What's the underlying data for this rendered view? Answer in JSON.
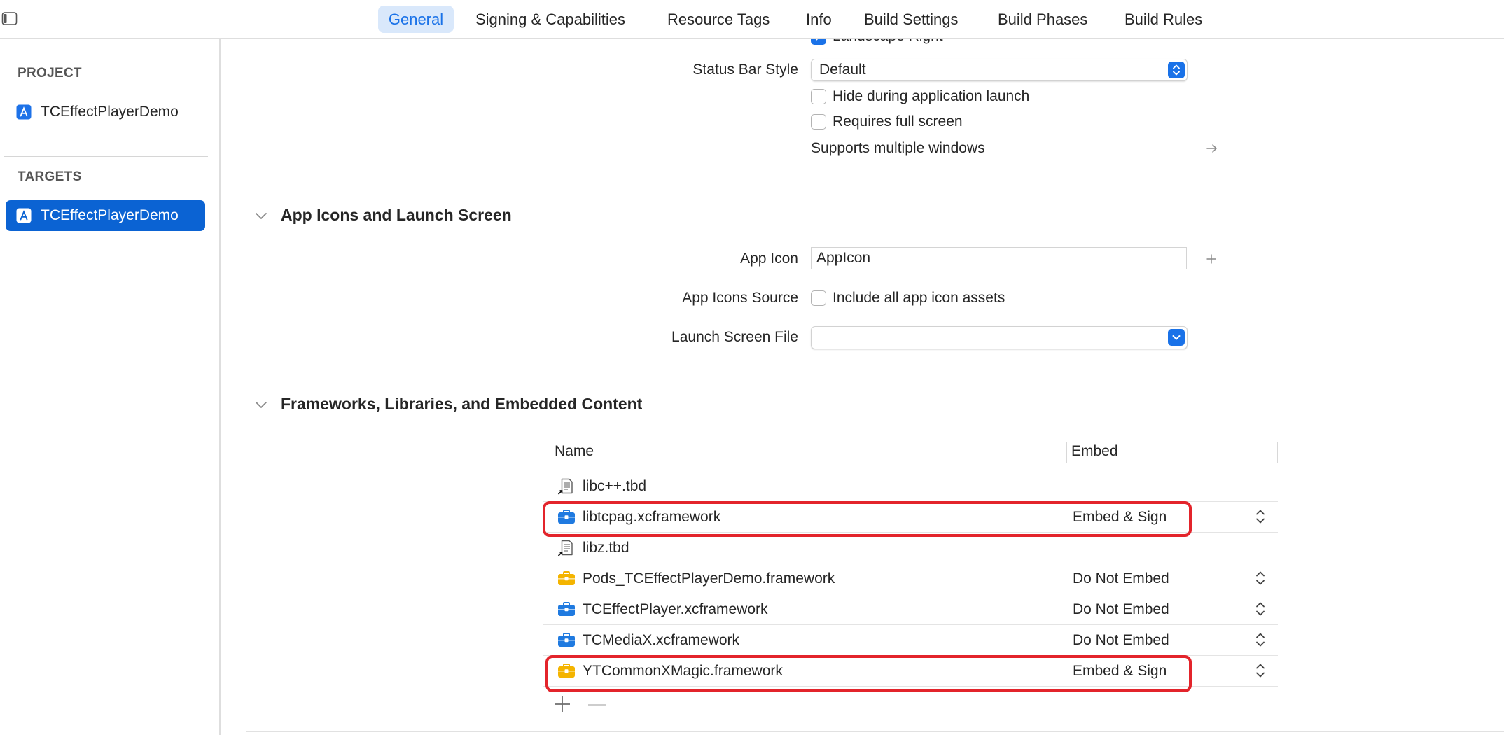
{
  "window": {
    "sidebar_toggle_icon": "sidebar-toggle-icon"
  },
  "tabs": [
    {
      "label": "General",
      "active": true
    },
    {
      "label": "Signing & Capabilities",
      "active": false
    },
    {
      "label": "Resource Tags",
      "active": false
    },
    {
      "label": "Info",
      "active": false
    },
    {
      "label": "Build Settings",
      "active": false
    },
    {
      "label": "Build Phases",
      "active": false
    },
    {
      "label": "Build Rules",
      "active": false
    }
  ],
  "sidebar": {
    "project_heading": "PROJECT",
    "project": {
      "label": "TCEffectPlayerDemo",
      "icon": "app-project-icon"
    },
    "targets_heading": "TARGETS",
    "targets": [
      {
        "label": "TCEffectPlayerDemo",
        "icon": "app-target-icon",
        "selected": true
      }
    ]
  },
  "deployment_info": {
    "landscape_right": {
      "label": "Landscape Right",
      "checked": true
    },
    "status_bar_style": {
      "label": "Status Bar Style",
      "value": "Default"
    },
    "hide_during_launch": {
      "label": "Hide during application launch",
      "checked": false
    },
    "requires_full_screen": {
      "label": "Requires full screen",
      "checked": false
    },
    "supports_multiple_windows": {
      "label": "Supports multiple windows",
      "icon": "arrow-right-icon"
    }
  },
  "app_icons_section": {
    "title": "App Icons and Launch Screen",
    "app_icon": {
      "label": "App Icon",
      "value": "AppIcon",
      "icon": "plus-icon"
    },
    "app_icons_source": {
      "label": "App Icons Source",
      "option": "Include all app icon assets",
      "checked": false
    },
    "launch_screen_file": {
      "label": "Launch Screen File",
      "value": ""
    }
  },
  "frameworks_section": {
    "title": "Frameworks, Libraries, and Embedded Content",
    "columns": {
      "name": "Name",
      "embed": "Embed"
    },
    "rows": [
      {
        "name": "libc++.tbd",
        "icon": "tbd-file-icon",
        "embed": "",
        "highlighted": false
      },
      {
        "name": "libtcpag.xcframework",
        "icon": "xcframework-icon",
        "embed": "Embed & Sign",
        "highlighted": true
      },
      {
        "name": "libz.tbd",
        "icon": "tbd-file-icon",
        "embed": "",
        "highlighted": false
      },
      {
        "name": "Pods_TCEffectPlayerDemo.framework",
        "icon": "framework-icon",
        "embed": "Do Not Embed",
        "highlighted": false
      },
      {
        "name": "TCEffectPlayer.xcframework",
        "icon": "xcframework-icon",
        "embed": "Do Not Embed",
        "highlighted": false
      },
      {
        "name": "TCMediaX.xcframework",
        "icon": "xcframework-icon",
        "embed": "Do Not Embed",
        "highlighted": false
      },
      {
        "name": "YTCommonXMagic.framework",
        "icon": "framework-icon",
        "embed": "Embed & Sign",
        "highlighted": true
      }
    ],
    "footer_icons": [
      "plus-icon",
      "minus-icon"
    ]
  },
  "colors": {
    "accent": "#1a72e8",
    "selection": "#0b63d3",
    "tab_active_bg": "#d9e8fb",
    "annotation": "#e3242b",
    "xcframework": "#1f7ae0",
    "framework": "#f4b400"
  }
}
